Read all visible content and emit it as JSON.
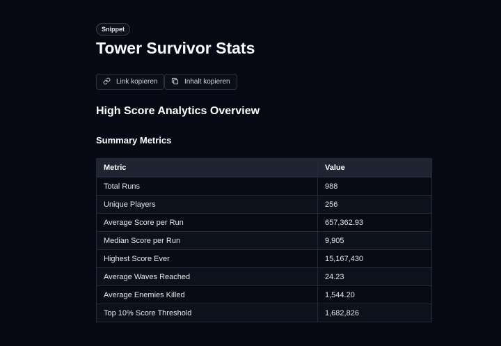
{
  "badge": "Snippet",
  "title": "Tower Survivor Stats",
  "actions": {
    "copy_link": "Link kopieren",
    "copy_content": "Inhalt kopieren"
  },
  "section_title": "High Score Analytics Overview",
  "subsection_title": "Summary Metrics",
  "table": {
    "headers": [
      "Metric",
      "Value"
    ],
    "rows": [
      [
        "Total Runs",
        "988"
      ],
      [
        "Unique Players",
        "256"
      ],
      [
        "Average Score per Run",
        "657,362.93"
      ],
      [
        "Median Score per Run",
        "9,905"
      ],
      [
        "Highest Score Ever",
        "15,167,430"
      ],
      [
        "Average Waves Reached",
        "24.23"
      ],
      [
        "Average Enemies Killed",
        "1,544.20"
      ],
      [
        "Top 10% Score Threshold",
        "1,682,826"
      ]
    ]
  }
}
